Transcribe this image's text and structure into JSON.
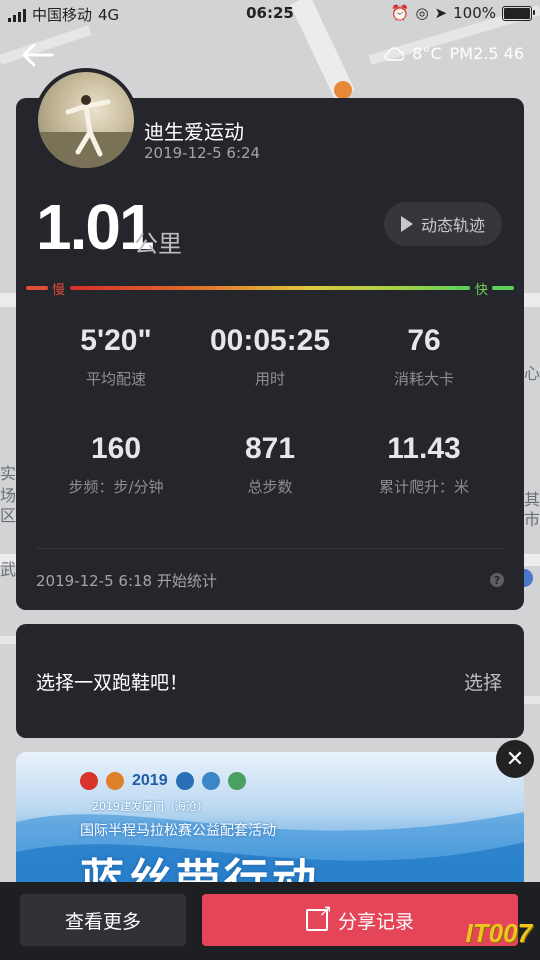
{
  "status_bar": {
    "carrier": "中国移动",
    "network": "4G",
    "time": "06:25",
    "battery": "100%"
  },
  "weather": {
    "temperature": "8°C",
    "pm25": "PM2.5 46",
    "icon": "cloud-icon"
  },
  "map_labels": [
    "实",
    "场",
    "区)",
    "武",
    "其",
    "市",
    "心"
  ],
  "record": {
    "user_name": "迪生爱运动",
    "date": "2019-12-5 6:24",
    "distance": "1.01",
    "distance_unit": "公里",
    "track_button": "动态轨迹",
    "speed_slow": "慢",
    "speed_fast": "快",
    "stats": [
      {
        "value": "5'20\"",
        "label": "平均配速"
      },
      {
        "value": "00:05:25",
        "label": "用时"
      },
      {
        "value": "76",
        "label": "消耗大卡"
      },
      {
        "value": "160",
        "label": "步频：步/分钟"
      },
      {
        "value": "871",
        "label": "总步数"
      },
      {
        "value": "11.43",
        "label": "累计爬升：米"
      }
    ],
    "start_text": "2019-12-5 6:18 开始统计",
    "help": "?"
  },
  "shoe": {
    "prompt": "选择一双跑鞋吧！",
    "select_label": "选择"
  },
  "banner": {
    "year": "2019",
    "line1": "2019建发厦门（海沧）",
    "line2": "国际半程马拉松赛公益配套活动",
    "big_text": "蓝丝带行动"
  },
  "actions": {
    "more_label": "查看更多",
    "share_label": "分享记录",
    "close_symbol": "✕"
  },
  "watermark": "IT007",
  "colors": {
    "card_bg": "#25262b",
    "share_button": "#e44558",
    "speed_slow": "#e24a3b",
    "speed_fast": "#5fd05a"
  }
}
